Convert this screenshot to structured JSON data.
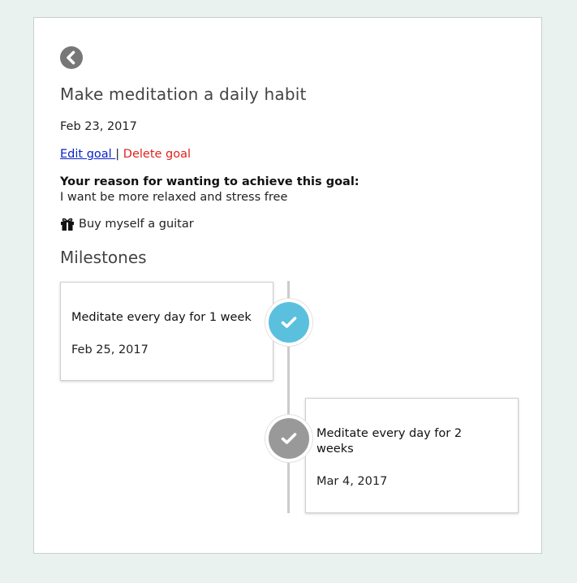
{
  "goal": {
    "title": "Make meditation a daily habit",
    "date": "Feb 23, 2017",
    "edit_label": "Edit goal ",
    "separator": "|",
    "delete_label": " Delete goal",
    "reason_heading": "Your reason for wanting to achieve this goal:",
    "reason_text": "I want be more relaxed and stress free",
    "reward_icon": "gift-icon",
    "reward_text": "Buy myself a guitar"
  },
  "back_icon": "chevron-left-icon",
  "milestones_heading": "Milestones",
  "milestones": [
    {
      "title": "Meditate every day for 1 week",
      "date": "Feb 25, 2017",
      "status_color": "#5bc0de",
      "icon": "check-icon"
    },
    {
      "title": "Meditate every day for 2 weeks",
      "date": "Mar 4, 2017",
      "status_color": "#999999",
      "icon": "check-icon"
    }
  ],
  "colors": {
    "page_background": "#eaf2f0",
    "link": "#0a22c9",
    "delete": "#e0221c",
    "timeline": "#cccccc"
  }
}
